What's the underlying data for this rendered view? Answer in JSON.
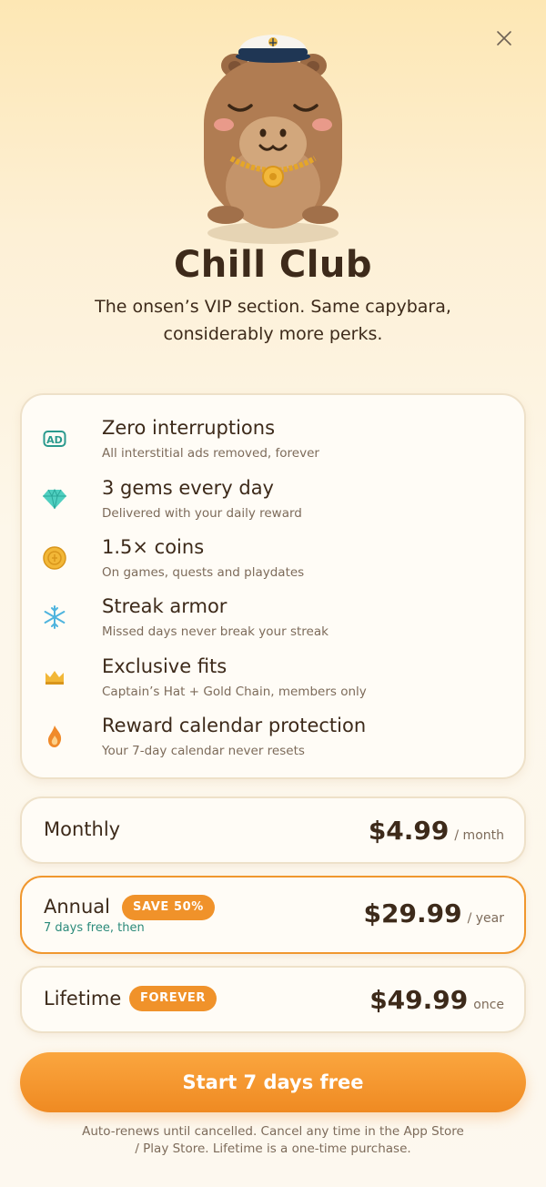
{
  "header": {
    "close_icon": "close-icon"
  },
  "hero": {
    "title": "Chill Club",
    "subtitle": "The onsen’s VIP section. Same capybara, considerably more perks."
  },
  "perks": [
    {
      "icon": "ad-icon",
      "title": "Zero interruptions",
      "desc": "All interstitial ads removed, forever"
    },
    {
      "icon": "gem-icon",
      "title": "3 gems every day",
      "desc": "Delivered with your daily reward"
    },
    {
      "icon": "coin-icon",
      "title": "1.5× coins",
      "desc": "On games, quests and playdates"
    },
    {
      "icon": "snowflake-icon",
      "title": "Streak armor",
      "desc": "Missed days never break your streak"
    },
    {
      "icon": "crown-icon",
      "title": "Exclusive fits",
      "desc": "Captain’s Hat + Gold Chain, members only"
    },
    {
      "icon": "flame-icon",
      "title": "Reward calendar protection",
      "desc": "Your 7-day calendar never resets"
    }
  ],
  "plans": {
    "monthly": {
      "name": "Monthly",
      "price": "$4.99",
      "period": "/ month"
    },
    "annual": {
      "name": "Annual",
      "badge": "SAVE 50%",
      "trial": "7 days free, then",
      "price": "$29.99",
      "period": "/ year",
      "selected": true
    },
    "lifetime": {
      "name": "Lifetime",
      "badge": "FOREVER",
      "price": "$49.99",
      "period": "once"
    }
  },
  "cta": {
    "label": "Start 7 days free"
  },
  "legal": {
    "text": "Auto-renews until cancelled. Cancel any time in the App Store / Play Store. Lifetime is a one-time purchase."
  },
  "colors": {
    "accent": "#f0922a",
    "text": "#3d2a1a",
    "muted": "#7d6b5a",
    "trial": "#2b8a7a"
  }
}
